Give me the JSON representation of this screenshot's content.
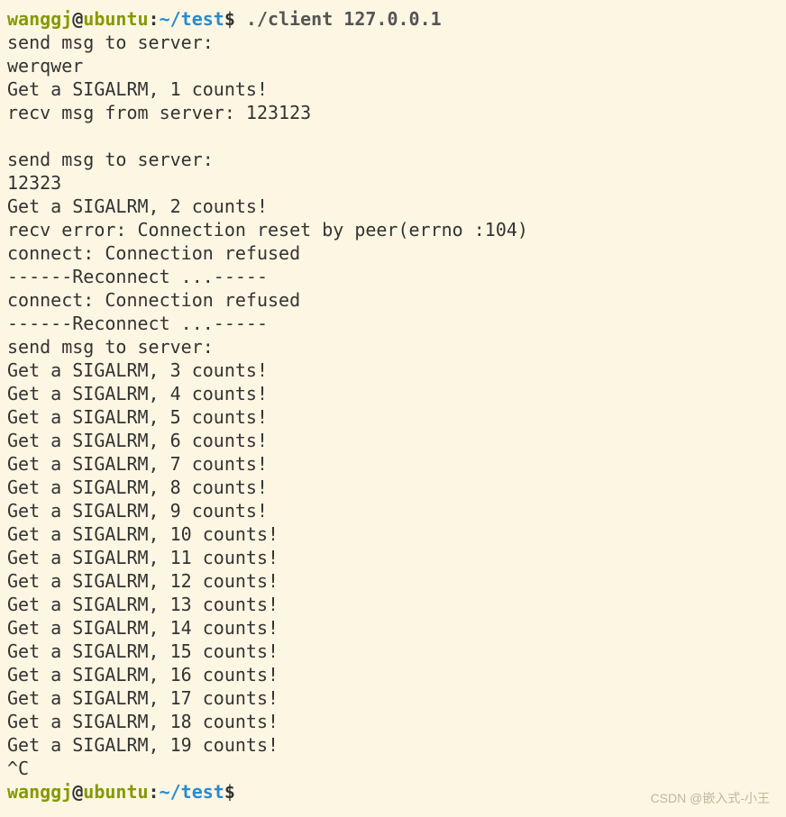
{
  "prompt1": {
    "user": "wanggj",
    "at": "@",
    "host": "ubuntu",
    "colon": ":",
    "path": "~/test",
    "dollar": "$",
    "command": " ./client 127.0.0.1"
  },
  "output_lines": [
    "send msg to server:",
    "werqwer",
    "Get a SIGALRM, 1 counts!",
    "recv msg from server: 123123",
    "",
    "send msg to server:",
    "12323",
    "Get a SIGALRM, 2 counts!",
    "recv error: Connection reset by peer(errno :104)",
    "connect: Connection refused",
    "------Reconnect ...-----",
    "connect: Connection refused",
    "------Reconnect ...-----",
    "send msg to server:",
    "Get a SIGALRM, 3 counts!",
    "Get a SIGALRM, 4 counts!",
    "Get a SIGALRM, 5 counts!",
    "Get a SIGALRM, 6 counts!",
    "Get a SIGALRM, 7 counts!",
    "Get a SIGALRM, 8 counts!",
    "Get a SIGALRM, 9 counts!",
    "Get a SIGALRM, 10 counts!",
    "Get a SIGALRM, 11 counts!",
    "Get a SIGALRM, 12 counts!",
    "Get a SIGALRM, 13 counts!",
    "Get a SIGALRM, 14 counts!",
    "Get a SIGALRM, 15 counts!",
    "Get a SIGALRM, 16 counts!",
    "Get a SIGALRM, 17 counts!",
    "Get a SIGALRM, 18 counts!",
    "Get a SIGALRM, 19 counts!",
    "^C"
  ],
  "prompt2": {
    "user": "wanggj",
    "at": "@",
    "host": "ubuntu",
    "colon": ":",
    "path": "~/test",
    "dollar": "$",
    "command": ""
  },
  "watermark": "CSDN @嵌入式-小王"
}
